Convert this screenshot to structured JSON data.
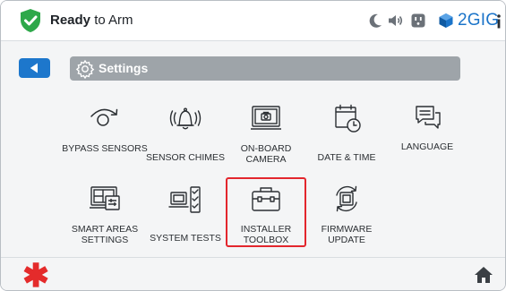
{
  "status_bar": {
    "status_bold": "Ready",
    "status_rest": " to Arm",
    "brand": "2GIG"
  },
  "page": {
    "title": "Settings"
  },
  "tiles": [
    {
      "label": "BYPASS SENSORS",
      "icon": "bypass-sensors-icon",
      "selected": false
    },
    {
      "label": "SENSOR CHIMES",
      "icon": "bell-icon",
      "selected": false
    },
    {
      "label": "ON-BOARD CAMERA",
      "icon": "camera-icon",
      "selected": false
    },
    {
      "label": "DATE & TIME",
      "icon": "calendar-clock-icon",
      "selected": false
    },
    {
      "label": "LANGUAGE",
      "icon": "speech-bubbles-icon",
      "selected": false
    },
    {
      "label": "SMART AREAS SETTINGS",
      "icon": "smart-areas-icon",
      "selected": false
    },
    {
      "label": "SYSTEM TESTS",
      "icon": "checklist-icon",
      "selected": false
    },
    {
      "label": "INSTALLER TOOLBOX",
      "icon": "toolbox-icon",
      "selected": true
    },
    {
      "label": "FIRMWARE UPDATE",
      "icon": "firmware-update-icon",
      "selected": false
    }
  ],
  "colors": {
    "accent": "#1d77cc",
    "ready_green": "#2ea84a",
    "selection": "#e3262d",
    "emergency": "#e42b2b"
  }
}
